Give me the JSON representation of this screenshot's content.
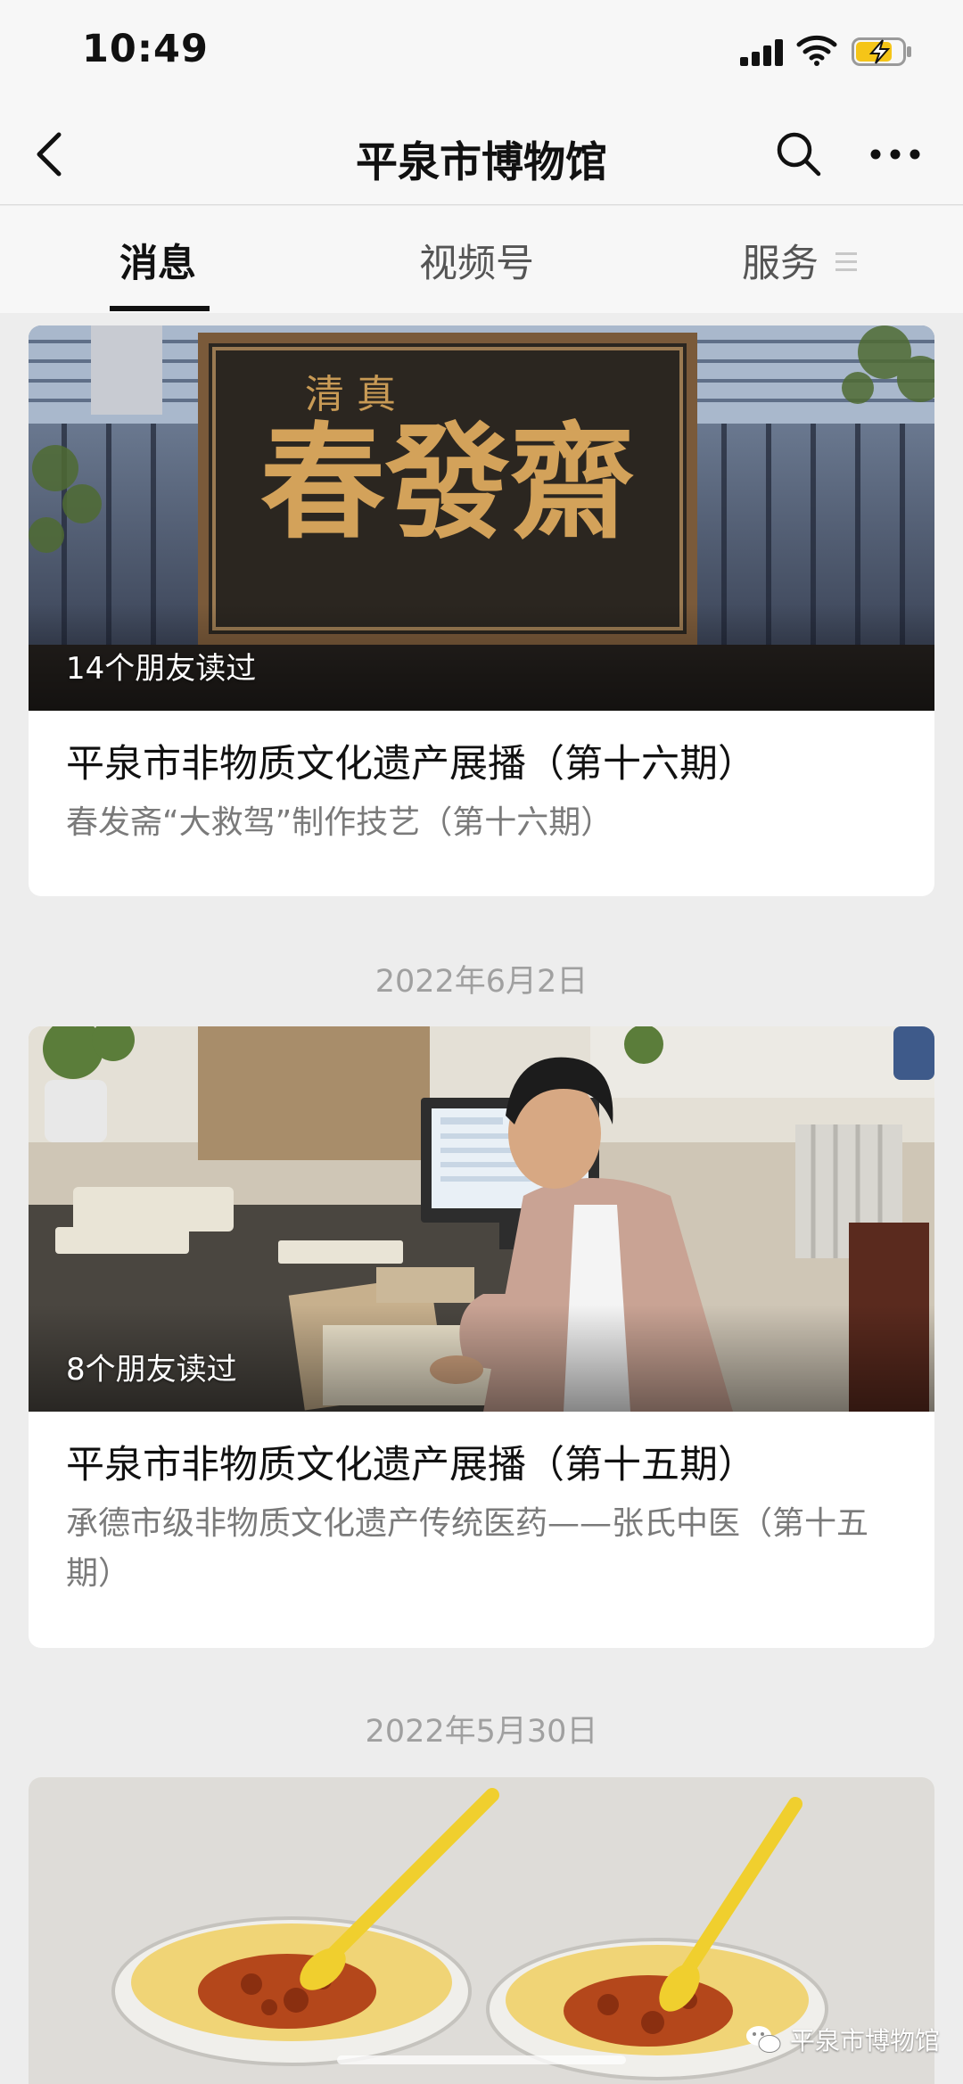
{
  "status": {
    "time": "10:49"
  },
  "nav": {
    "title": "平泉市博物馆"
  },
  "tabs": [
    {
      "label": "消息",
      "active": true
    },
    {
      "label": "视频号",
      "active": false
    },
    {
      "label": "服务",
      "active": false
    }
  ],
  "feed": {
    "cards": [
      {
        "image": "signboard-photo",
        "signboard_small": "清 真",
        "signboard_large": "春發齋",
        "read_count": "14个朋友读过",
        "title": "平泉市非物质文化遗产展播（第十六期）",
        "subtitle": "春发斋“大救驾”制作技艺（第十六期）"
      },
      {
        "image": "doctor-desk-photo",
        "read_count": "8个朋友读过",
        "title": "平泉市非物质文化遗产展播（第十五期）",
        "subtitle": "承德市级非物质文化遗产传统医药——张氏中医（第十五期）"
      },
      {
        "image": "pudding-bowls-photo"
      }
    ],
    "dates": [
      "2022年6月2日",
      "2022年5月30日"
    ]
  },
  "watermark": {
    "text": "平泉市博物馆"
  },
  "colors": {
    "background": "#ededed",
    "card": "#ffffff",
    "secondary_text": "#7a7a7a",
    "battery_fill": "#f5c518"
  }
}
